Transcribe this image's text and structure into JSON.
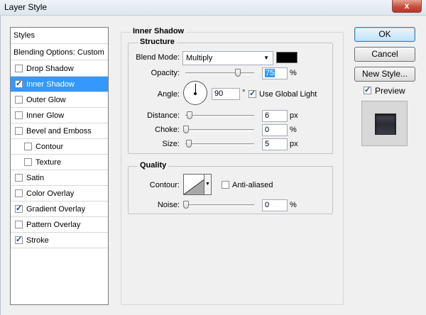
{
  "window": {
    "title": "Layer Style",
    "close_label": "x"
  },
  "styles_list": {
    "header": "Styles",
    "blending": "Blending Options: Custom",
    "items": [
      {
        "label": "Drop Shadow",
        "checked": false
      },
      {
        "label": "Inner Shadow",
        "checked": true,
        "selected": true
      },
      {
        "label": "Outer Glow",
        "checked": false
      },
      {
        "label": "Inner Glow",
        "checked": false
      },
      {
        "label": "Bevel and Emboss",
        "checked": false
      },
      {
        "label": "Contour",
        "checked": false
      },
      {
        "label": "Texture",
        "checked": false
      },
      {
        "label": "Satin",
        "checked": false
      },
      {
        "label": "Color Overlay",
        "checked": false
      },
      {
        "label": "Gradient Overlay",
        "checked": true
      },
      {
        "label": "Pattern Overlay",
        "checked": false
      },
      {
        "label": "Stroke",
        "checked": true
      }
    ]
  },
  "inner_shadow": {
    "title": "Inner Shadow",
    "structure": {
      "title": "Structure",
      "blend_mode_label": "Blend Mode:",
      "blend_mode_value": "Multiply",
      "shadow_color": "#000000",
      "opacity_label": "Opacity:",
      "opacity_value": "75",
      "opacity_unit": "%",
      "angle_label": "Angle:",
      "angle_value": "90",
      "angle_unit": "°",
      "use_global_light": "Use Global Light",
      "distance_label": "Distance:",
      "distance_value": "6",
      "distance_unit": "px",
      "choke_label": "Choke:",
      "choke_value": "0",
      "choke_unit": "%",
      "size_label": "Size:",
      "size_value": "5",
      "size_unit": "px"
    },
    "quality": {
      "title": "Quality",
      "contour_label": "Contour:",
      "anti_aliased": "Anti-aliased",
      "noise_label": "Noise:",
      "noise_value": "0",
      "noise_unit": "%"
    }
  },
  "buttons": {
    "ok": "OK",
    "cancel": "Cancel",
    "new_style": "New Style...",
    "preview": "Preview"
  },
  "colors": {
    "selection": "#3399ff",
    "close_button": "#c7503a"
  }
}
